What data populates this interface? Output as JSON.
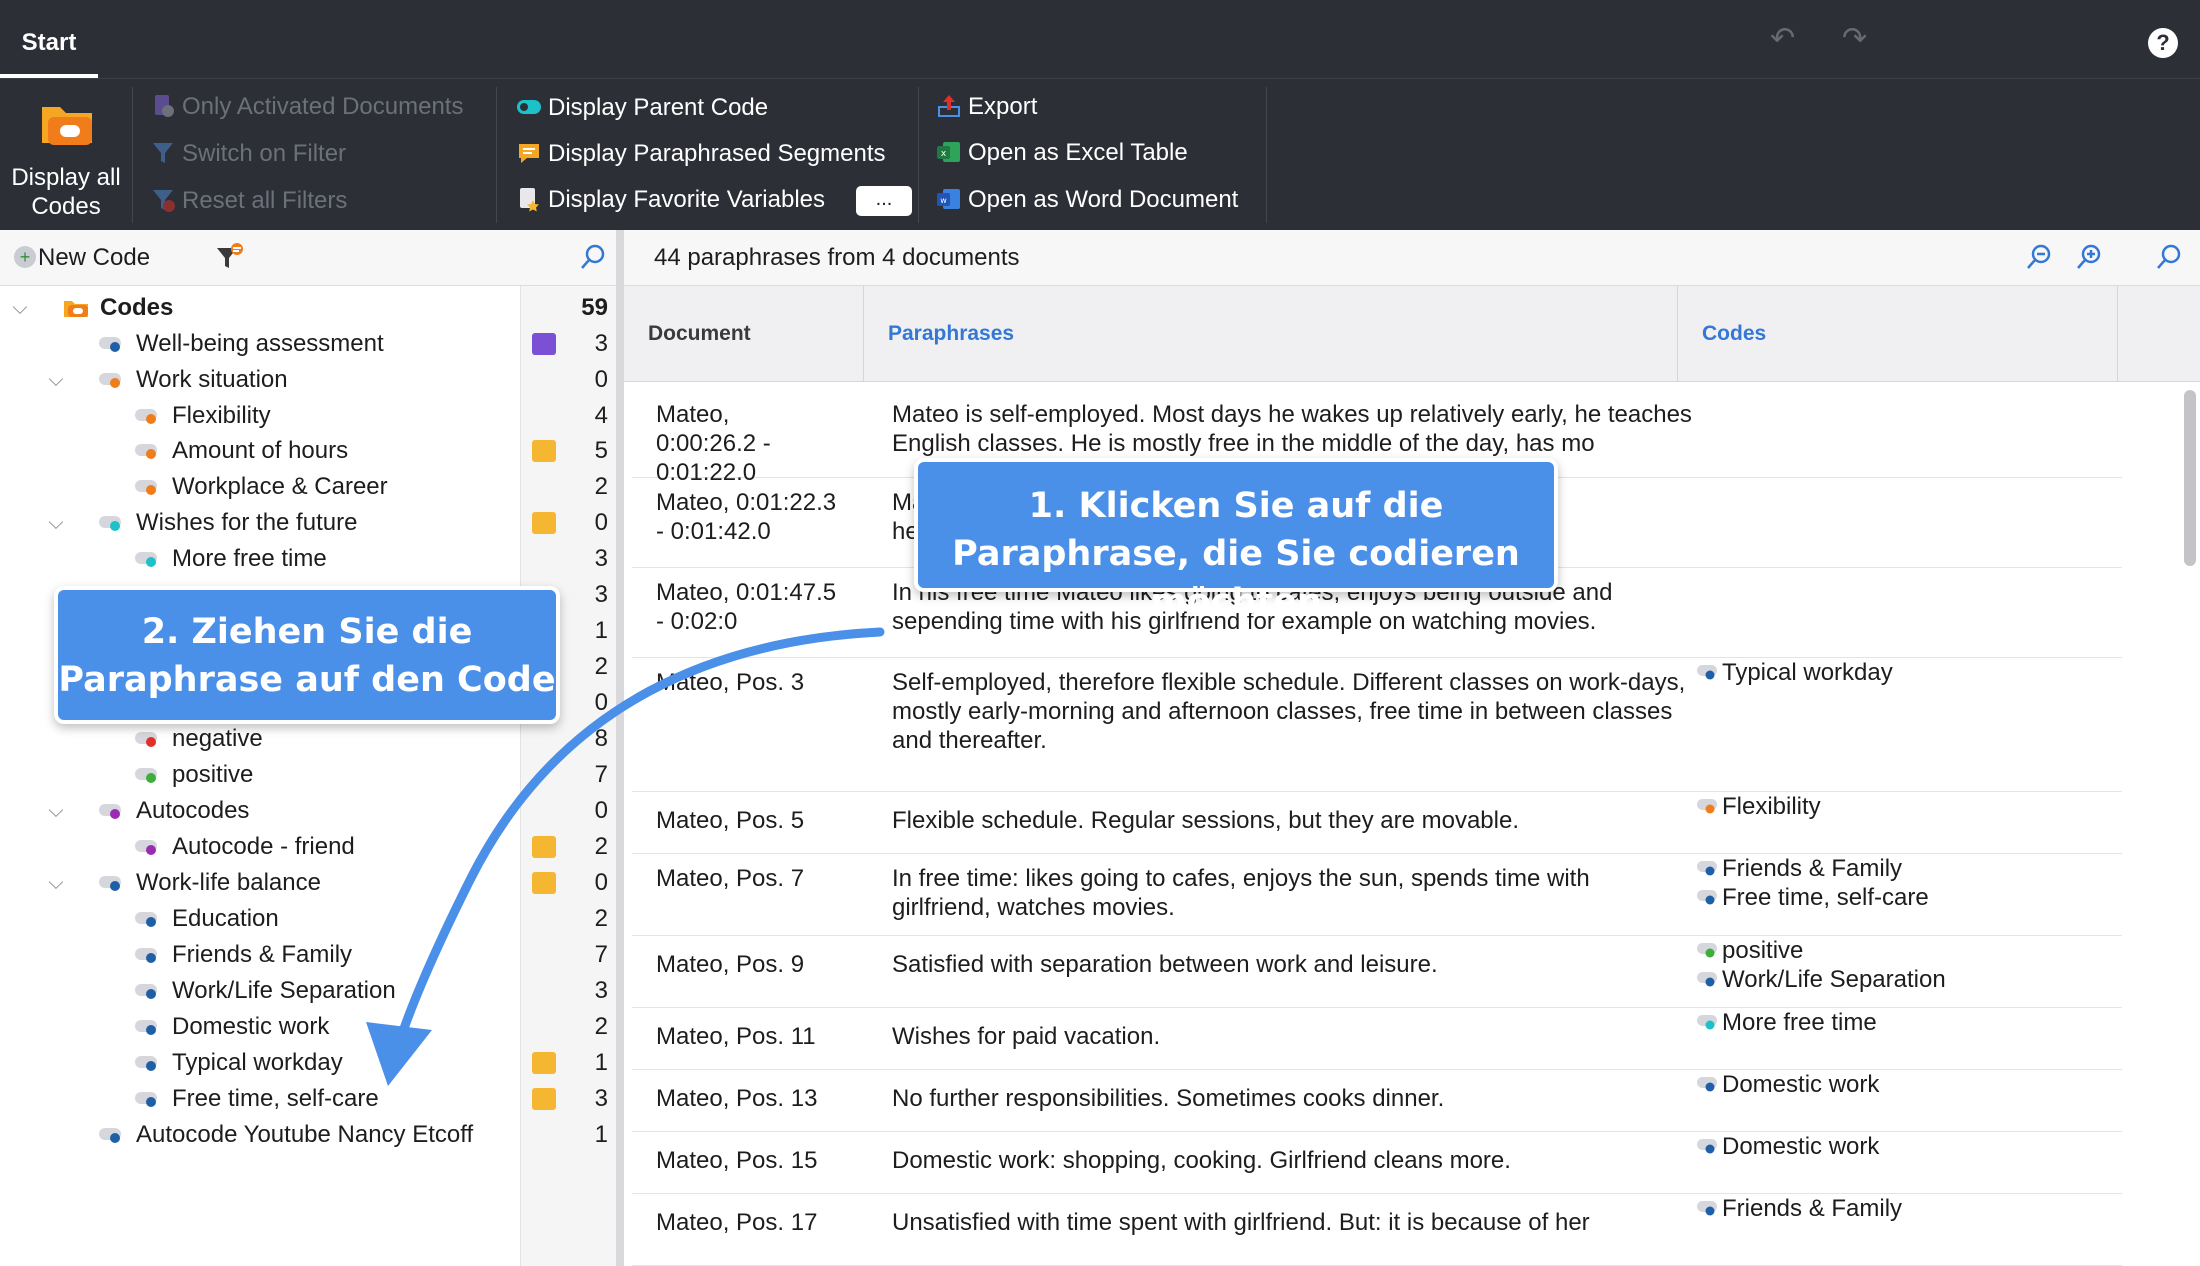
{
  "tabbar": {
    "start_tab": "Start",
    "help": "?"
  },
  "ribbon": {
    "display_all_codes": "Display all Codes",
    "only_activated": "Only Activated Documents",
    "switch_filter": "Switch on Filter",
    "reset_filters": "Reset all Filters",
    "display_parent": "Display Parent Code",
    "display_paraphrased": "Display Paraphrased Segments",
    "display_favorite": "Display Favorite Variables",
    "more": "...",
    "export": "Export",
    "open_excel": "Open as Excel Table",
    "open_word": "Open as Word Document"
  },
  "left": {
    "new_code": "New Code",
    "tree": [
      {
        "label": "Codes",
        "count": "59",
        "level": 0,
        "expand": true,
        "bold": true,
        "icon": "root-folder",
        "memo": ""
      },
      {
        "label": "Well-being assessment",
        "count": "3",
        "level": 1,
        "expand": false,
        "dot": "#1f5fa8",
        "memo": "#7b4fd6"
      },
      {
        "label": "Work situation",
        "count": "0",
        "level": 1,
        "expand": true,
        "dot": "#f07c1a",
        "memo": ""
      },
      {
        "label": "Flexibility",
        "count": "4",
        "level": 2,
        "expand": false,
        "dot": "#f07c1a",
        "memo": ""
      },
      {
        "label": "Amount of hours",
        "count": "5",
        "level": 2,
        "expand": false,
        "dot": "#f07c1a",
        "memo": "#f5b731"
      },
      {
        "label": "Workplace & Career",
        "count": "2",
        "level": 2,
        "expand": false,
        "dot": "#f07c1a",
        "memo": ""
      },
      {
        "label": "Wishes for the future",
        "count": "0",
        "level": 1,
        "expand": true,
        "dot": "#1cc1c9",
        "memo": "#f5b731"
      },
      {
        "label": "More free time",
        "count": "3",
        "level": 2,
        "expand": false,
        "dot": "#1cc1c9",
        "memo": ""
      },
      {
        "label": "",
        "count": "3",
        "level": 2,
        "expand": false,
        "dot": "",
        "memo": ""
      },
      {
        "label": "",
        "count": "1",
        "level": 2,
        "expand": false,
        "dot": "",
        "memo": ""
      },
      {
        "label": "",
        "count": "2",
        "level": 2,
        "expand": false,
        "dot": "",
        "memo": ""
      },
      {
        "label": "",
        "count": "0",
        "level": 1,
        "expand": false,
        "dot": "",
        "memo": ""
      },
      {
        "label": "negative",
        "count": "8",
        "level": 2,
        "expand": false,
        "dot": "#e0302a",
        "memo": ""
      },
      {
        "label": "positive",
        "count": "7",
        "level": 2,
        "expand": false,
        "dot": "#3cae3a",
        "memo": ""
      },
      {
        "label": "Autocodes",
        "count": "0",
        "level": 1,
        "expand": true,
        "dot": "#9b2bb3",
        "memo": ""
      },
      {
        "label": "Autocode - friend",
        "count": "2",
        "level": 2,
        "expand": false,
        "dot": "#9b2bb3",
        "memo": "#f5b731"
      },
      {
        "label": "Work-life balance",
        "count": "0",
        "level": 1,
        "expand": true,
        "dot": "#1f5fa8",
        "memo": "#f5b731"
      },
      {
        "label": "Education",
        "count": "2",
        "level": 2,
        "expand": false,
        "dot": "#1f5fa8",
        "memo": ""
      },
      {
        "label": "Friends & Family",
        "count": "7",
        "level": 2,
        "expand": false,
        "dot": "#1f5fa8",
        "memo": ""
      },
      {
        "label": "Work/Life Separation",
        "count": "3",
        "level": 2,
        "expand": false,
        "dot": "#1f5fa8",
        "memo": ""
      },
      {
        "label": "Domestic work",
        "count": "2",
        "level": 2,
        "expand": false,
        "dot": "#1f5fa8",
        "memo": ""
      },
      {
        "label": "Typical workday",
        "count": "1",
        "level": 2,
        "expand": false,
        "dot": "#1f5fa8",
        "memo": "#f5b731"
      },
      {
        "label": "Free time, self-care",
        "count": "3",
        "level": 2,
        "expand": false,
        "dot": "#1f5fa8",
        "memo": "#f5b731"
      },
      {
        "label": "Autocode Youtube Nancy Etcoff",
        "count": "1",
        "level": 1,
        "expand": false,
        "dot": "#1f5fa8",
        "memo": ""
      }
    ]
  },
  "right": {
    "summary": "44 paraphrases from 4 documents",
    "columns": {
      "document": "Document",
      "paraphrases": "Paraphrases",
      "codes": "Codes"
    },
    "rows": [
      {
        "doc": "Mateo,\n0:00:26.2 -\n0:01:22.0",
        "text": "Mateo is self-employed. Most days he wakes up relatively early, he teaches English classes. He is mostly free in the middle of the day, has mo",
        "codes": []
      },
      {
        "doc": "Mateo, 0:01:22.3\n- 0:01:42.0",
        "text": "Ma                                                                                    ns, but\nhe",
        "codes": []
      },
      {
        "doc": "Mateo, 0:01:47.5\n- 0:02:0",
        "text": "In his free time Mateo likes going to cafes, enjoys being outside and sepending time with his girlfriend for example on watching movies.",
        "codes": []
      },
      {
        "doc": "Mateo, Pos. 3",
        "text": "Self-employed, therefore flexible schedule. Different classes on work-days, mostly early-morning and afternoon classes, free time in between classes and thereafter.",
        "codes": [
          {
            "name": "Typical workday",
            "color": "#1f5fa8"
          }
        ]
      },
      {
        "doc": "Mateo, Pos. 5",
        "text": "Flexible schedule. Regular sessions, but they are movable.",
        "codes": [
          {
            "name": "Flexibility",
            "color": "#f07c1a"
          }
        ]
      },
      {
        "doc": "Mateo, Pos. 7",
        "text": "In free time: likes going to cafes, enjoys the sun, spends time with girlfriend, watches movies.",
        "codes": [
          {
            "name": "Friends & Family",
            "color": "#1f5fa8"
          },
          {
            "name": "Free time, self-care",
            "color": "#1f5fa8"
          }
        ]
      },
      {
        "doc": "Mateo, Pos. 9",
        "text": "Satisfied with separation between work and leisure.",
        "codes": [
          {
            "name": "positive",
            "color": "#3cae3a"
          },
          {
            "name": "Work/Life Separation",
            "color": "#1f5fa8"
          }
        ]
      },
      {
        "doc": "Mateo, Pos. 11",
        "text": "Wishes for paid vacation.",
        "codes": [
          {
            "name": "More free time",
            "color": "#1cc1c9"
          }
        ]
      },
      {
        "doc": "Mateo, Pos. 13",
        "text": "No further responsibilities. Sometimes cooks dinner.",
        "codes": [
          {
            "name": "Domestic work",
            "color": "#1f5fa8"
          }
        ]
      },
      {
        "doc": "Mateo, Pos. 15",
        "text": "Domestic work: shopping, cooking. Girlfriend cleans more.",
        "codes": [
          {
            "name": "Domestic work",
            "color": "#1f5fa8"
          }
        ]
      },
      {
        "doc": "Mateo, Pos. 17",
        "text": "Unsatisfied with time spent with girlfriend. But: it is because of her",
        "codes": [
          {
            "name": "Friends & Family",
            "color": "#1f5fa8"
          }
        ]
      }
    ]
  },
  "callouts": {
    "step1": "1. Klicken Sie auf die Paraphrase, die Sie codieren möchten",
    "step2": "2. Ziehen Sie die Paraphrase auf den Code"
  },
  "colors": {
    "accent": "#4a8fe8",
    "toolbar_bg": "#2d2f37",
    "link_blue": "#3478d6"
  }
}
